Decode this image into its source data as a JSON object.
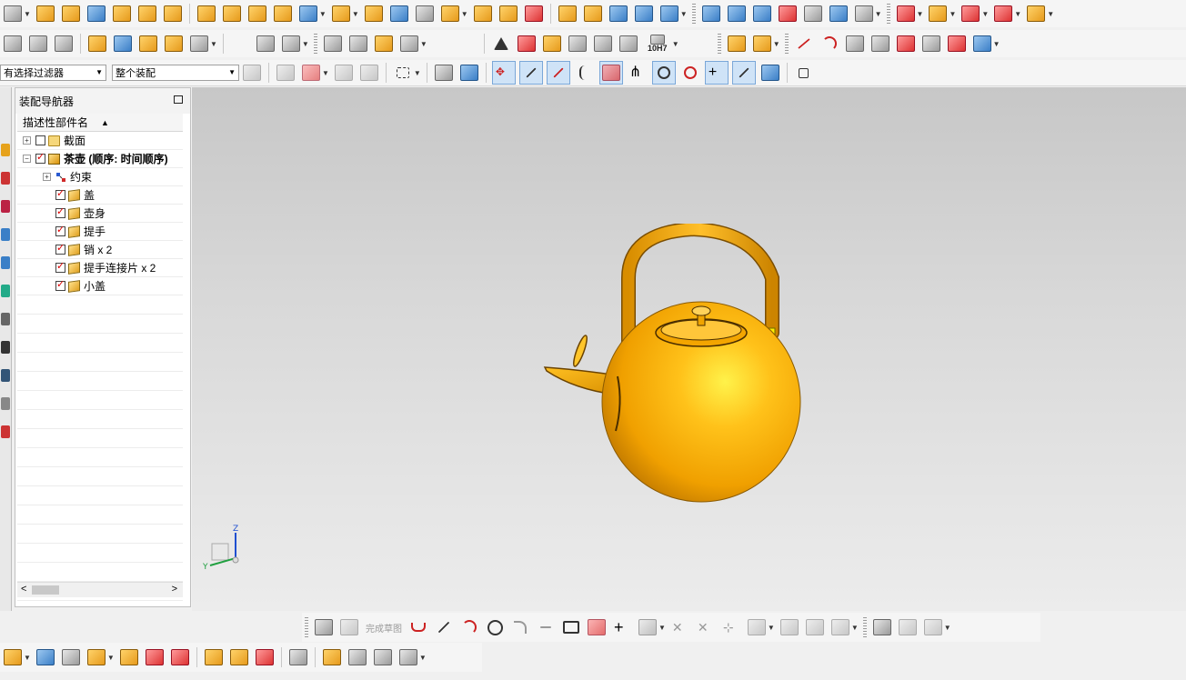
{
  "toolbar": {
    "filter_select": "有选择过滤器",
    "scope_select": "整个装配",
    "tolerance_label": "10H7"
  },
  "navigator": {
    "title": "装配导航器",
    "column_header": "描述性部件名",
    "items": [
      {
        "label": "截面",
        "level": 0,
        "expander": "+",
        "checked": false,
        "icon": "folder-icon",
        "bold": false
      },
      {
        "label": "茶壶 (顺序: 时间顺序)",
        "level": 0,
        "expander": "–",
        "checked": true,
        "icon": "assembly-icon",
        "bold": true
      },
      {
        "label": "约束",
        "level": 1,
        "expander": "+",
        "checked": null,
        "icon": "constraints-icon",
        "bold": false
      },
      {
        "label": "盖",
        "level": 1,
        "expander": null,
        "checked": true,
        "icon": "part-icon",
        "bold": false
      },
      {
        "label": "壶身",
        "level": 1,
        "expander": null,
        "checked": true,
        "icon": "part-icon",
        "bold": false
      },
      {
        "label": "提手",
        "level": 1,
        "expander": null,
        "checked": true,
        "icon": "part-icon",
        "bold": false
      },
      {
        "label": "销 x 2",
        "level": 1,
        "expander": null,
        "checked": true,
        "icon": "part-icon",
        "bold": false
      },
      {
        "label": "提手连接片 x 2",
        "level": 1,
        "expander": null,
        "checked": true,
        "icon": "part-icon",
        "bold": false
      },
      {
        "label": "小盖",
        "level": 1,
        "expander": null,
        "checked": true,
        "icon": "part-icon",
        "bold": false
      }
    ]
  },
  "sketch": {
    "finish_label": "完成草图"
  },
  "triad": {
    "z_label": "Z",
    "y_label": "Y"
  },
  "colors": {
    "model": "#f5a900",
    "viewport_top": "#c7c7c7",
    "viewport_bottom": "#ececec"
  }
}
